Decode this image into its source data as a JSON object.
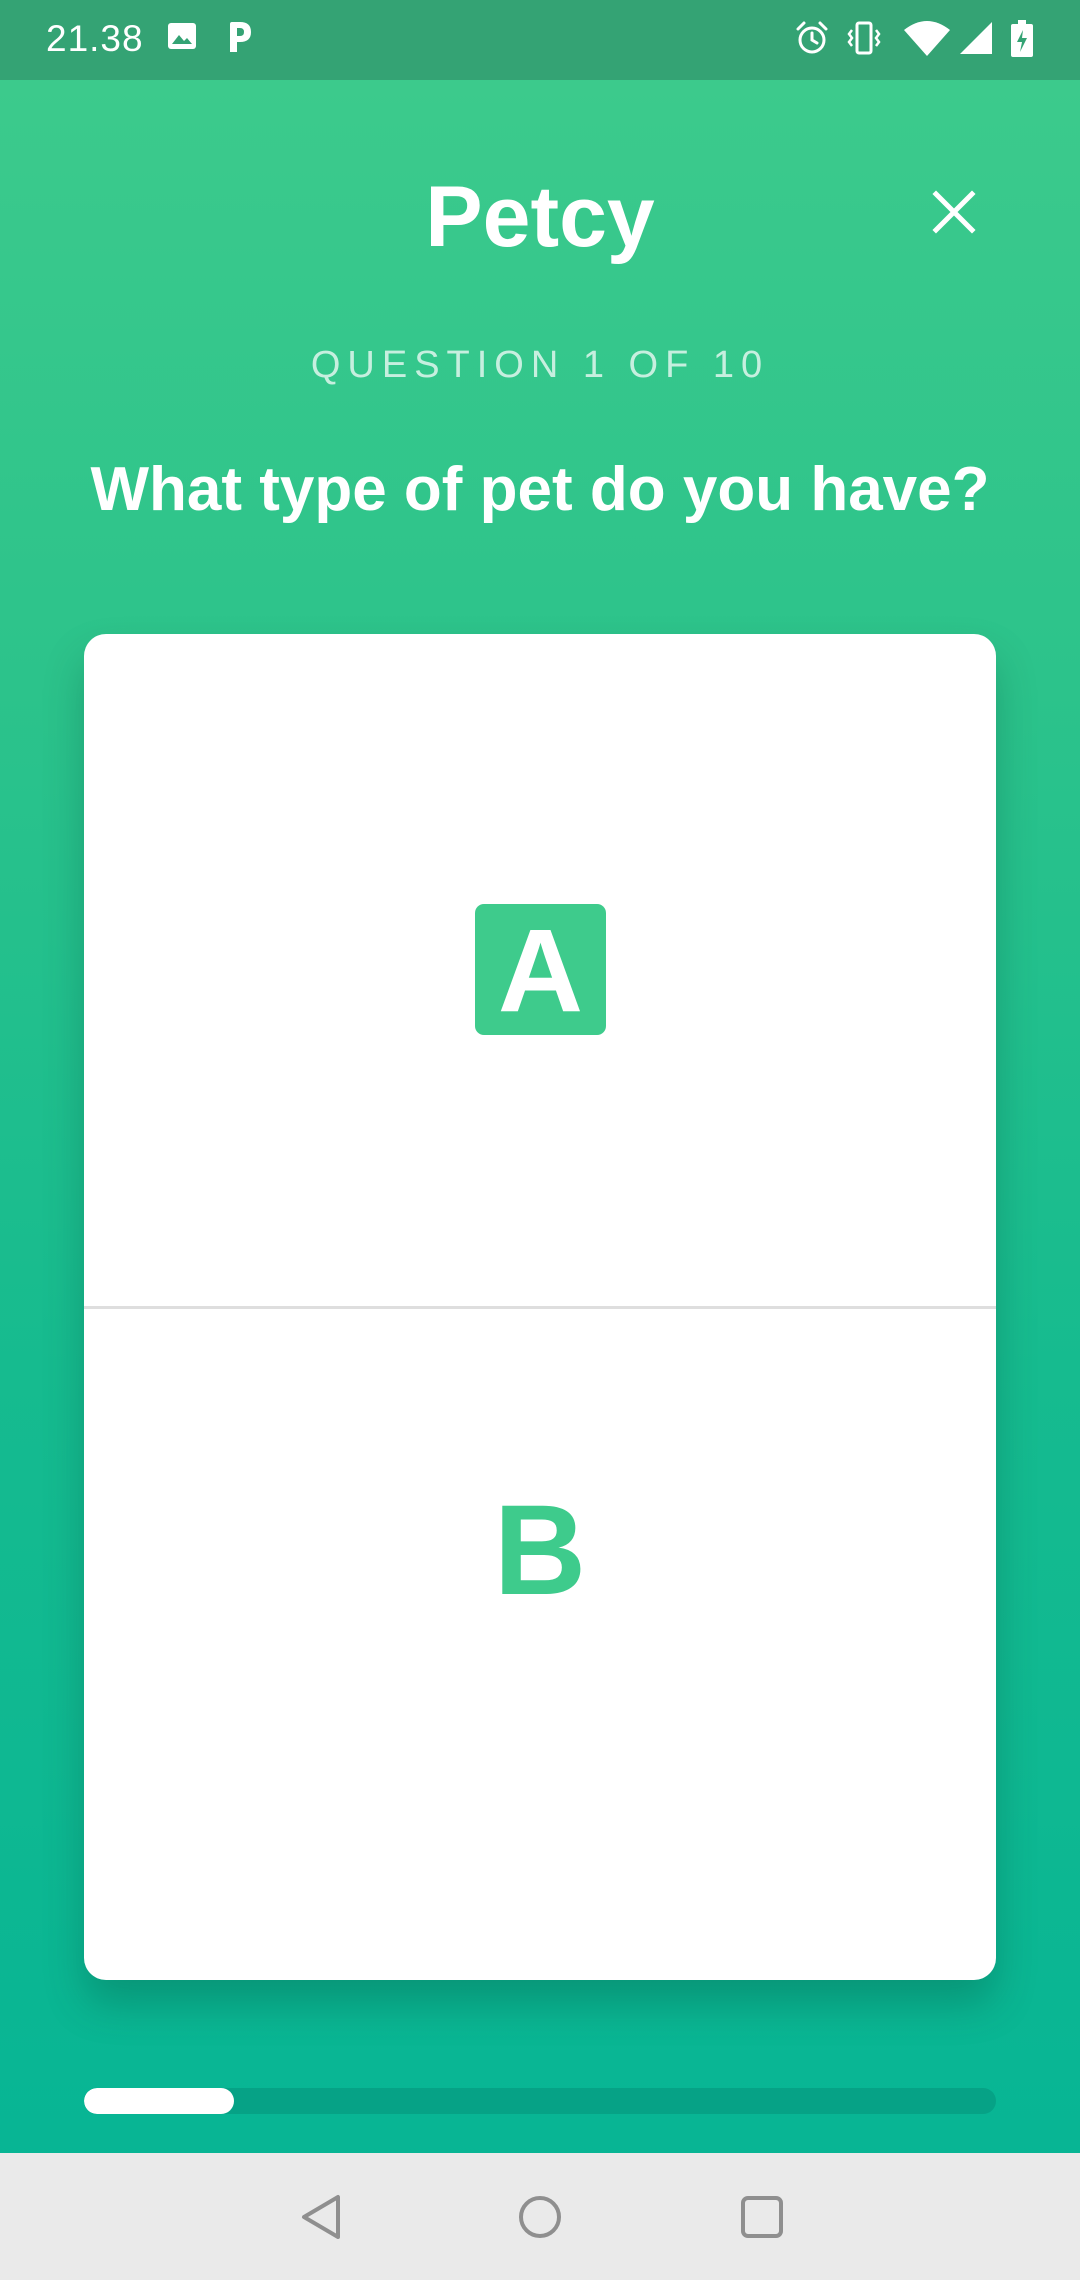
{
  "status_bar": {
    "time": "21.38",
    "icons": [
      "image-icon",
      "parking-icon",
      "alarm-icon",
      "vibrate-icon",
      "wifi-icon",
      "signal-icon",
      "battery-charging-icon"
    ]
  },
  "header": {
    "title": "Petcy",
    "close_icon": "close-icon"
  },
  "quiz": {
    "counter": "QUESTION 1 OF 10",
    "question": "What type of pet do you have?",
    "options": [
      {
        "label": "A"
      },
      {
        "label": "B"
      }
    ],
    "progress": 0.1
  },
  "nav": {
    "icons": [
      "back-icon",
      "home-icon",
      "recents-icon"
    ]
  },
  "colors": {
    "accent": "#3ecb8c",
    "status_bar": "#34a374",
    "progress_track": "#06a286",
    "nav_bar": "#eaeaea"
  }
}
